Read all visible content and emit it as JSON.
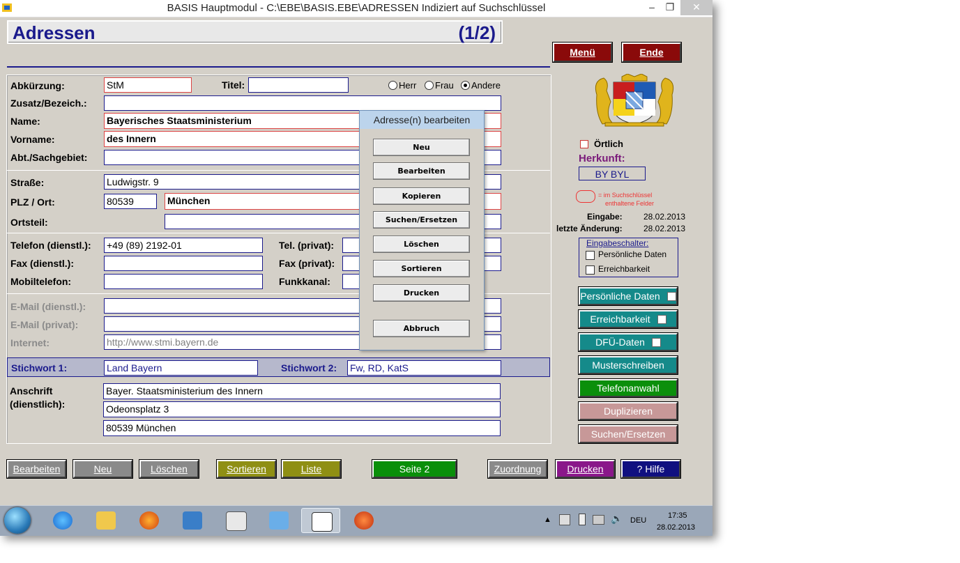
{
  "window": {
    "title": "BASIS Hauptmodul - C:\\EBE\\BASIS.EBE\\ADRESSEN Indiziert auf Suchschlüssel",
    "minimize": "–",
    "maximize": "❐",
    "close": "✕"
  },
  "header": {
    "title": "Adressen",
    "count": "(1/2)"
  },
  "top_buttons": {
    "menu": "Menü",
    "end": "Ende"
  },
  "form": {
    "abkuerzung_label": "Abkürzung:",
    "abkuerzung": "StM",
    "titel_label": "Titel:",
    "titel": "",
    "anrede": {
      "herr": "Herr",
      "frau": "Frau",
      "andere": "Andere",
      "selected": "Andere"
    },
    "zusatz_label": "Zusatz/Bezeich.:",
    "zusatz": "",
    "name_label": "Name:",
    "name": "Bayerisches Staatsministerium",
    "vorname_label": "Vorname:",
    "vorname": "des Innern",
    "abt_label": "Abt./Sachgebiet:",
    "abt": "",
    "strasse_label": "Straße:",
    "strasse": "Ludwigstr. 9",
    "plz_label": "PLZ / Ort:",
    "plz": "80539",
    "ort": "München",
    "ortsteil_label": "Ortsteil:",
    "ortsteil": "",
    "tel_d_label": "Telefon (dienstl.):",
    "tel_d": "+49 (89) 2192-01",
    "tel_p_label": "Tel. (privat):",
    "tel_p": "",
    "fax_d_label": "Fax (dienstl.):",
    "fax_d": "",
    "fax_p_label": "Fax (privat):",
    "fax_p": "",
    "mobil_label": "Mobiltelefon:",
    "mobil": "",
    "funk_label": "Funkkanal:",
    "funk": "",
    "email_d_label": "E-Mail (dienstl.):",
    "email_d": "",
    "email_p_label": "E-Mail (privat):",
    "email_p": "",
    "internet_label": "Internet:",
    "internet": "http://www.stmi.bayern.de",
    "stich1_label": "Stichwort 1:",
    "stich1": "Land Bayern",
    "stich2_label": "Stichwort 2:",
    "stich2": "Fw, RD, KatS",
    "anschrift_label1": "Anschrift",
    "anschrift_label2": "(dienstlich):",
    "anschrift": [
      "Bayer. Staatsministerium des Innern",
      "Odeonsplatz 3",
      "80539 München"
    ]
  },
  "dialog": {
    "title": "Adresse(n) bearbeiten",
    "buttons": [
      "Neu",
      "Bearbeiten",
      "Kopieren",
      "Suchen/Ersetzen",
      "Löschen",
      "Sortieren",
      "Drucken"
    ],
    "cancel": "Abbruch"
  },
  "side": {
    "oertlich": "Örtlich",
    "herkunft_label": "Herkunft:",
    "herkunft": "BY BYL",
    "legend1": "= im Suchschlüssel",
    "legend2": "enthaltene Felder",
    "eingabe_label": "Eingabe:",
    "eingabe": "28.02.2013",
    "aenderung_label": "letzte Änderung:",
    "aenderung": "28.02.2013",
    "schalter_title": "Eingabeschalter:",
    "schalter1": "Persönliche Daten",
    "schalter2": "Erreichbarkeit",
    "buttons": {
      "persoenlich": "Persönliche Daten",
      "erreichbarkeit": "Erreichbarkeit",
      "dfue": "DFÜ-Daten",
      "muster": "Musterschreiben",
      "telefon": "Telefonanwahl",
      "dupl": "Duplizieren",
      "suchen": "Suchen/Ersetzen"
    }
  },
  "bottom_buttons": {
    "bearbeiten": "Bearbeiten",
    "neu": "Neu",
    "loeschen": "Löschen",
    "sortieren": "Sortieren",
    "liste": "Liste",
    "seite2": "Seite 2",
    "zuordnung": "Zuordnung",
    "drucken": "Drucken",
    "hilfe": "?  Hilfe"
  },
  "taskbar": {
    "lang": "DEU",
    "time": "17:35",
    "date": "28.02.2013"
  },
  "colors": {
    "navy": "#1a1a8c",
    "teal": "#158a8a",
    "maroon": "#8a0a0a",
    "green": "#0a8f0a"
  }
}
